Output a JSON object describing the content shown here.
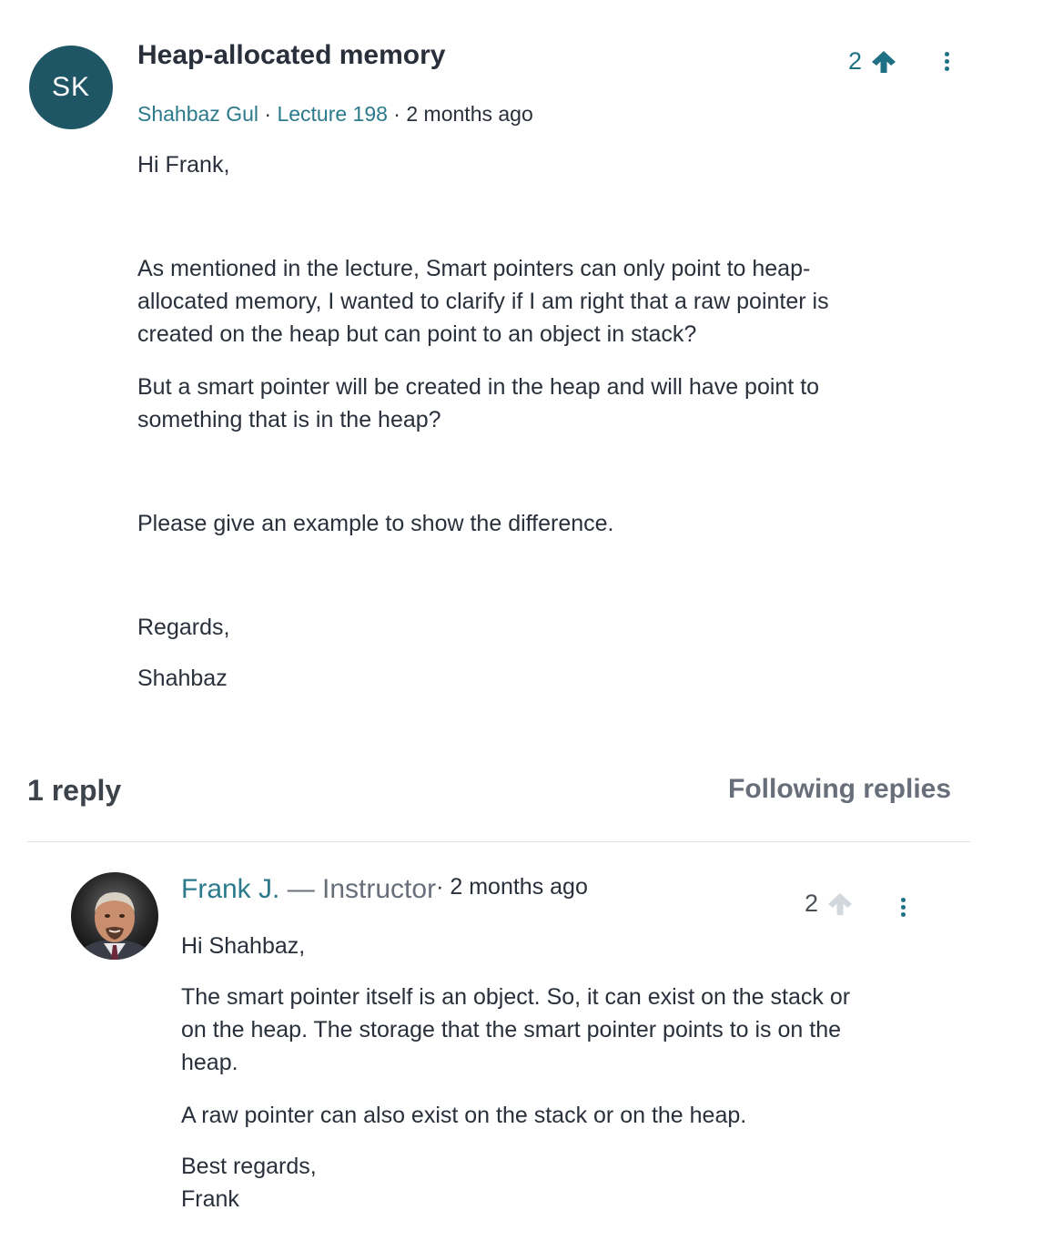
{
  "question": {
    "avatar_initials": "SK",
    "title": "Heap-allocated memory",
    "author": "Shahbaz Gul",
    "meta_sep1": " · ",
    "lecture": "Lecture 198",
    "meta_sep2": " · ",
    "time": "2 months ago",
    "vote_count": "2",
    "body": [
      "Hi Frank,",
      "As mentioned in the lecture, Smart pointers can only point to heap-",
      "allocated memory, I wanted to clarify if I am right that a raw pointer is",
      "created on the heap but can point to an object in stack?",
      "But a smart pointer will be created in the heap and will have point to",
      "something that is in the heap?",
      "Please give an example to show the difference.",
      "Regards,",
      "Shahbaz"
    ]
  },
  "replies_header": {
    "count_label": "1 reply",
    "following_label": "Following replies"
  },
  "reply": {
    "author": "Frank J.",
    "role": " — Instructor",
    "time_sep": "· ",
    "time": "2 months ago",
    "vote_count": "2",
    "body": [
      "Hi Shahbaz,",
      "The smart pointer itself is an object. So, it can exist on the stack or",
      "on the heap. The storage that the smart pointer points to is on the",
      "heap.",
      "A raw pointer can also exist on the stack or on the heap.",
      "Best regards,",
      "Frank"
    ]
  },
  "colors": {
    "accent": "#2b7a8c",
    "avatar_bg": "#1f5666",
    "text": "#29303b",
    "muted": "#686f7a",
    "upvote_active": "#1f6f85",
    "upvote_inactive": "#d1d7dc"
  },
  "icons": {
    "upvote": "arrow-up-icon",
    "more": "kebab-menu-icon"
  }
}
